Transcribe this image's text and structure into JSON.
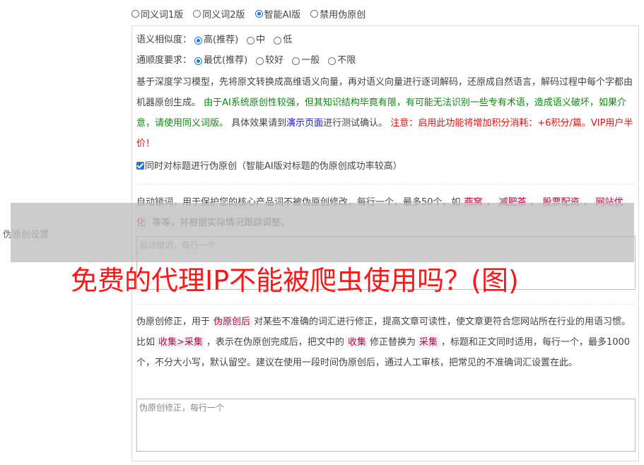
{
  "version_options": [
    {
      "label": "同义词1版",
      "checked": false
    },
    {
      "label": "同义词2版",
      "checked": false
    },
    {
      "label": "智能AI版",
      "checked": true
    },
    {
      "label": "禁用伪原创",
      "checked": false
    }
  ],
  "side_label": "伪原创设置",
  "similarity": {
    "label": "语义相似度：",
    "options": [
      {
        "label": "高(推荐)",
        "checked": true
      },
      {
        "label": "中",
        "checked": false
      },
      {
        "label": "低",
        "checked": false
      }
    ]
  },
  "fluency": {
    "label": "通顺度要求：",
    "options": [
      {
        "label": "最优(推荐)",
        "checked": true
      },
      {
        "label": "较好",
        "checked": false
      },
      {
        "label": "一般",
        "checked": false
      },
      {
        "label": "不限",
        "checked": false
      }
    ]
  },
  "ai_description": {
    "part1": "基于深度学习模型，先将原文转换成高维语义向量，再对语义向量进行逐词解码，还原成自然语言，解码过程中每个字都由机器原创生成。 ",
    "part2_green": "由于AI系统原创性较强，但其知识结构毕竟有限，有可能无法识别一些专有术语，造成语义破坏，如果介意，请使用同义词版。",
    "part3": " 具体效果请到",
    "demo_link": "演示页面",
    "part4": "进行测试确认。 ",
    "part5_red": "注意：启用此功能将增加积分消耗：+6积分/篇。VIP用户半价！"
  },
  "title_checkbox": {
    "checked": true,
    "label": "同时对标题进行伪原创（智能AI版对标题的伪原创成功率较高）"
  },
  "lock_words": {
    "desc1": "自动锁词，用于保护您的核心产品词不被伪原创修改，每行一个，最多50个，如",
    "tags": [
      "燕窝",
      "减肥茶",
      "股票配资",
      "网站优化"
    ],
    "desc2": "等等，并根据实际情况跟踪调整。",
    "placeholder": "自动锁词，每行一个"
  },
  "correction": {
    "desc1": "伪原创修正，用于",
    "tag1": "伪原创后",
    "desc2": "对某些不准确的词汇进行修正，提高文章可读性，使文章更符合您网站所在行业的用语习惯。比如",
    "tag2": "收集>采集",
    "desc3": "，表示在伪原创完成后，把文中的",
    "tag3": "收集",
    "desc4": "修正替换为",
    "tag4": "采集",
    "desc5": "，标题和正文同时适用，每行一个，最多1000个，不分大小写，默认留空。建议在使用一段时间伪原创后，通过人工审核，把常见的不准确词汇设置在此。",
    "placeholder": "伪原创修正，每行一个"
  },
  "watermark_text": "免费的代理IP不能被爬虫使用吗？(图)"
}
